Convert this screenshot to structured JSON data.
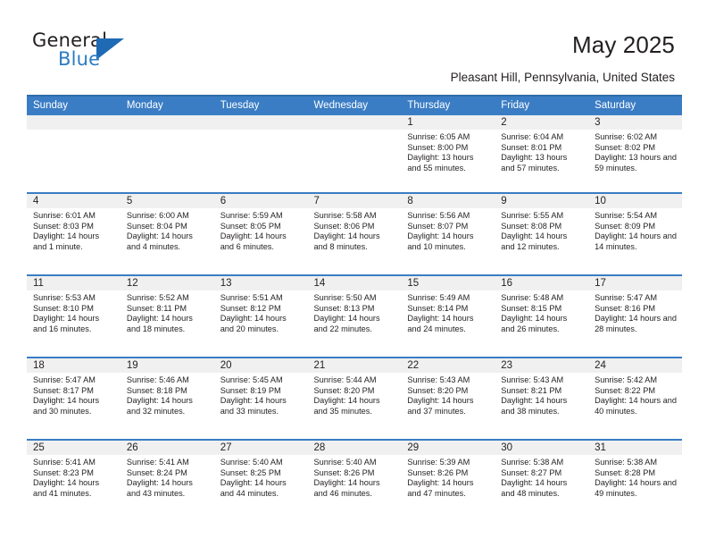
{
  "brand": {
    "name_top": "General",
    "name_bottom": "Blue",
    "triangle_icon": "triangle-icon",
    "accent_color": "#2b7cc4"
  },
  "header": {
    "title": "May 2025",
    "location": "Pleasant Hill, Pennsylvania, United States"
  },
  "theme": {
    "header_blue": "#3b7dc4",
    "band_gray": "#f0f0f0",
    "text": "#231f20"
  },
  "weekdays": [
    "Sunday",
    "Monday",
    "Tuesday",
    "Wednesday",
    "Thursday",
    "Friday",
    "Saturday"
  ],
  "calendar_data": {
    "type": "table",
    "month": "May",
    "year": 2025,
    "weeks": [
      [
        {
          "day": ""
        },
        {
          "day": ""
        },
        {
          "day": ""
        },
        {
          "day": ""
        },
        {
          "day": "1",
          "sunrise": "Sunrise: 6:05 AM",
          "sunset": "Sunset: 8:00 PM",
          "daylight": "Daylight: 13 hours and 55 minutes."
        },
        {
          "day": "2",
          "sunrise": "Sunrise: 6:04 AM",
          "sunset": "Sunset: 8:01 PM",
          "daylight": "Daylight: 13 hours and 57 minutes."
        },
        {
          "day": "3",
          "sunrise": "Sunrise: 6:02 AM",
          "sunset": "Sunset: 8:02 PM",
          "daylight": "Daylight: 13 hours and 59 minutes."
        }
      ],
      [
        {
          "day": "4",
          "sunrise": "Sunrise: 6:01 AM",
          "sunset": "Sunset: 8:03 PM",
          "daylight": "Daylight: 14 hours and 1 minute."
        },
        {
          "day": "5",
          "sunrise": "Sunrise: 6:00 AM",
          "sunset": "Sunset: 8:04 PM",
          "daylight": "Daylight: 14 hours and 4 minutes."
        },
        {
          "day": "6",
          "sunrise": "Sunrise: 5:59 AM",
          "sunset": "Sunset: 8:05 PM",
          "daylight": "Daylight: 14 hours and 6 minutes."
        },
        {
          "day": "7",
          "sunrise": "Sunrise: 5:58 AM",
          "sunset": "Sunset: 8:06 PM",
          "daylight": "Daylight: 14 hours and 8 minutes."
        },
        {
          "day": "8",
          "sunrise": "Sunrise: 5:56 AM",
          "sunset": "Sunset: 8:07 PM",
          "daylight": "Daylight: 14 hours and 10 minutes."
        },
        {
          "day": "9",
          "sunrise": "Sunrise: 5:55 AM",
          "sunset": "Sunset: 8:08 PM",
          "daylight": "Daylight: 14 hours and 12 minutes."
        },
        {
          "day": "10",
          "sunrise": "Sunrise: 5:54 AM",
          "sunset": "Sunset: 8:09 PM",
          "daylight": "Daylight: 14 hours and 14 minutes."
        }
      ],
      [
        {
          "day": "11",
          "sunrise": "Sunrise: 5:53 AM",
          "sunset": "Sunset: 8:10 PM",
          "daylight": "Daylight: 14 hours and 16 minutes."
        },
        {
          "day": "12",
          "sunrise": "Sunrise: 5:52 AM",
          "sunset": "Sunset: 8:11 PM",
          "daylight": "Daylight: 14 hours and 18 minutes."
        },
        {
          "day": "13",
          "sunrise": "Sunrise: 5:51 AM",
          "sunset": "Sunset: 8:12 PM",
          "daylight": "Daylight: 14 hours and 20 minutes."
        },
        {
          "day": "14",
          "sunrise": "Sunrise: 5:50 AM",
          "sunset": "Sunset: 8:13 PM",
          "daylight": "Daylight: 14 hours and 22 minutes."
        },
        {
          "day": "15",
          "sunrise": "Sunrise: 5:49 AM",
          "sunset": "Sunset: 8:14 PM",
          "daylight": "Daylight: 14 hours and 24 minutes."
        },
        {
          "day": "16",
          "sunrise": "Sunrise: 5:48 AM",
          "sunset": "Sunset: 8:15 PM",
          "daylight": "Daylight: 14 hours and 26 minutes."
        },
        {
          "day": "17",
          "sunrise": "Sunrise: 5:47 AM",
          "sunset": "Sunset: 8:16 PM",
          "daylight": "Daylight: 14 hours and 28 minutes."
        }
      ],
      [
        {
          "day": "18",
          "sunrise": "Sunrise: 5:47 AM",
          "sunset": "Sunset: 8:17 PM",
          "daylight": "Daylight: 14 hours and 30 minutes."
        },
        {
          "day": "19",
          "sunrise": "Sunrise: 5:46 AM",
          "sunset": "Sunset: 8:18 PM",
          "daylight": "Daylight: 14 hours and 32 minutes."
        },
        {
          "day": "20",
          "sunrise": "Sunrise: 5:45 AM",
          "sunset": "Sunset: 8:19 PM",
          "daylight": "Daylight: 14 hours and 33 minutes."
        },
        {
          "day": "21",
          "sunrise": "Sunrise: 5:44 AM",
          "sunset": "Sunset: 8:20 PM",
          "daylight": "Daylight: 14 hours and 35 minutes."
        },
        {
          "day": "22",
          "sunrise": "Sunrise: 5:43 AM",
          "sunset": "Sunset: 8:20 PM",
          "daylight": "Daylight: 14 hours and 37 minutes."
        },
        {
          "day": "23",
          "sunrise": "Sunrise: 5:43 AM",
          "sunset": "Sunset: 8:21 PM",
          "daylight": "Daylight: 14 hours and 38 minutes."
        },
        {
          "day": "24",
          "sunrise": "Sunrise: 5:42 AM",
          "sunset": "Sunset: 8:22 PM",
          "daylight": "Daylight: 14 hours and 40 minutes."
        }
      ],
      [
        {
          "day": "25",
          "sunrise": "Sunrise: 5:41 AM",
          "sunset": "Sunset: 8:23 PM",
          "daylight": "Daylight: 14 hours and 41 minutes."
        },
        {
          "day": "26",
          "sunrise": "Sunrise: 5:41 AM",
          "sunset": "Sunset: 8:24 PM",
          "daylight": "Daylight: 14 hours and 43 minutes."
        },
        {
          "day": "27",
          "sunrise": "Sunrise: 5:40 AM",
          "sunset": "Sunset: 8:25 PM",
          "daylight": "Daylight: 14 hours and 44 minutes."
        },
        {
          "day": "28",
          "sunrise": "Sunrise: 5:40 AM",
          "sunset": "Sunset: 8:26 PM",
          "daylight": "Daylight: 14 hours and 46 minutes."
        },
        {
          "day": "29",
          "sunrise": "Sunrise: 5:39 AM",
          "sunset": "Sunset: 8:26 PM",
          "daylight": "Daylight: 14 hours and 47 minutes."
        },
        {
          "day": "30",
          "sunrise": "Sunrise: 5:38 AM",
          "sunset": "Sunset: 8:27 PM",
          "daylight": "Daylight: 14 hours and 48 minutes."
        },
        {
          "day": "31",
          "sunrise": "Sunrise: 5:38 AM",
          "sunset": "Sunset: 8:28 PM",
          "daylight": "Daylight: 14 hours and 49 minutes."
        }
      ]
    ]
  }
}
